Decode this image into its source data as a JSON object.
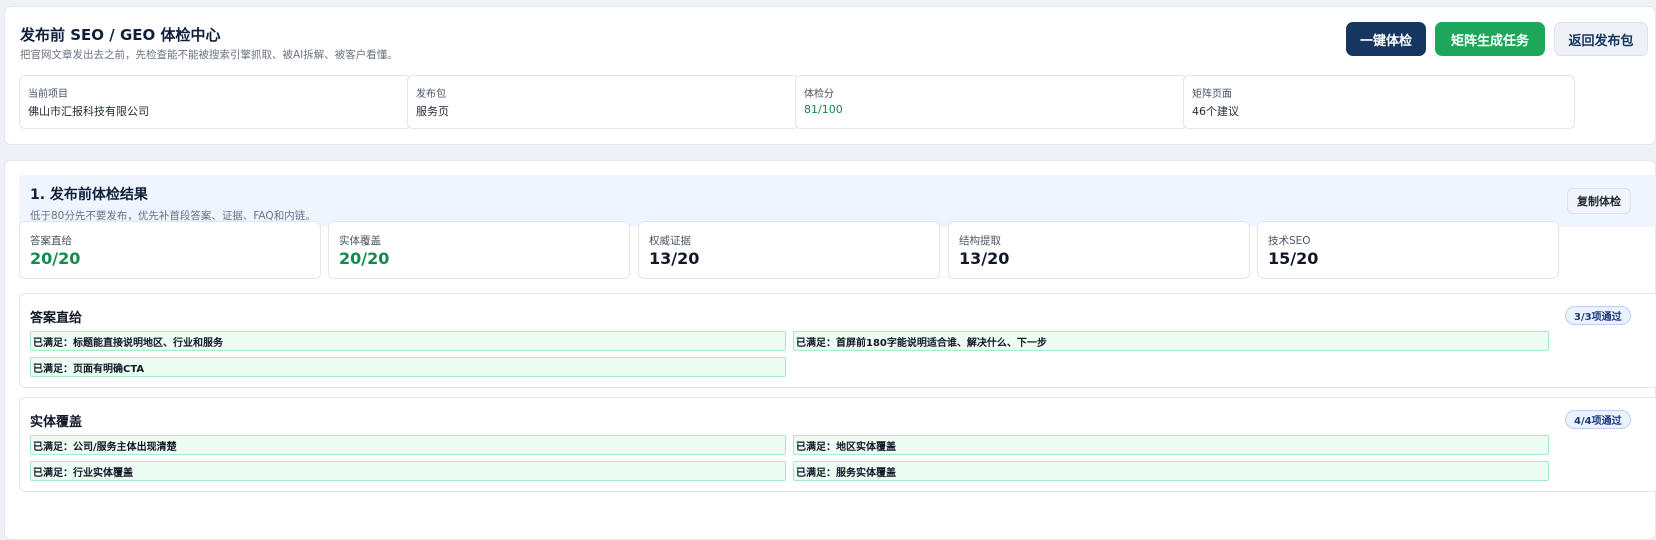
{
  "header": {
    "title": "发布前 SEO / GEO 体检中心",
    "subtitle": "把官网文章发出去之前，先检查能不能被搜索引擎抓取、被AI拆解、被客户看懂。",
    "buttons": {
      "check": "一键体检",
      "generate": "矩阵生成任务",
      "back": "返回发布包"
    }
  },
  "info_cards": [
    {
      "label": "当前项目",
      "value": "佛山市汇报科技有限公司"
    },
    {
      "label": "发布包",
      "value": "服务页"
    },
    {
      "label": "体检分",
      "value": "81/100"
    },
    {
      "label": "矩阵页面",
      "value": "46个建议"
    }
  ],
  "section": {
    "title": "1. 发布前体检结果",
    "subtitle": "低于80分先不要发布，优先补首段答案、证据、FAQ和内链。",
    "copy_button": "复制体检"
  },
  "scores": [
    {
      "label": "答案直给",
      "value": "20/20"
    },
    {
      "label": "实体覆盖",
      "value": "20/20"
    },
    {
      "label": "权威证据",
      "value": "13/20"
    },
    {
      "label": "结构提取",
      "value": "13/20"
    },
    {
      "label": "技术SEO",
      "value": "15/20"
    }
  ],
  "groups": [
    {
      "title": "答案直给",
      "badge": "3/3项通过",
      "items": [
        "已满足：标题能直接说明地区、行业和服务",
        "已满足：首屏前180字能说明适合谁、解决什么、下一步",
        "已满足：页面有明确CTA"
      ]
    },
    {
      "title": "实体覆盖",
      "badge": "4/4项通过",
      "items": [
        "已满足：公司/服务主体出现清楚",
        "已满足：地区实体覆盖",
        "已满足：行业实体覆盖",
        "已满足：服务实体覆盖"
      ]
    }
  ],
  "colors": {
    "primary_dark": "#14365f",
    "success_green": "#1ea65a",
    "score_green": "#138a4c",
    "pass_bg": "#ecfdf3"
  }
}
